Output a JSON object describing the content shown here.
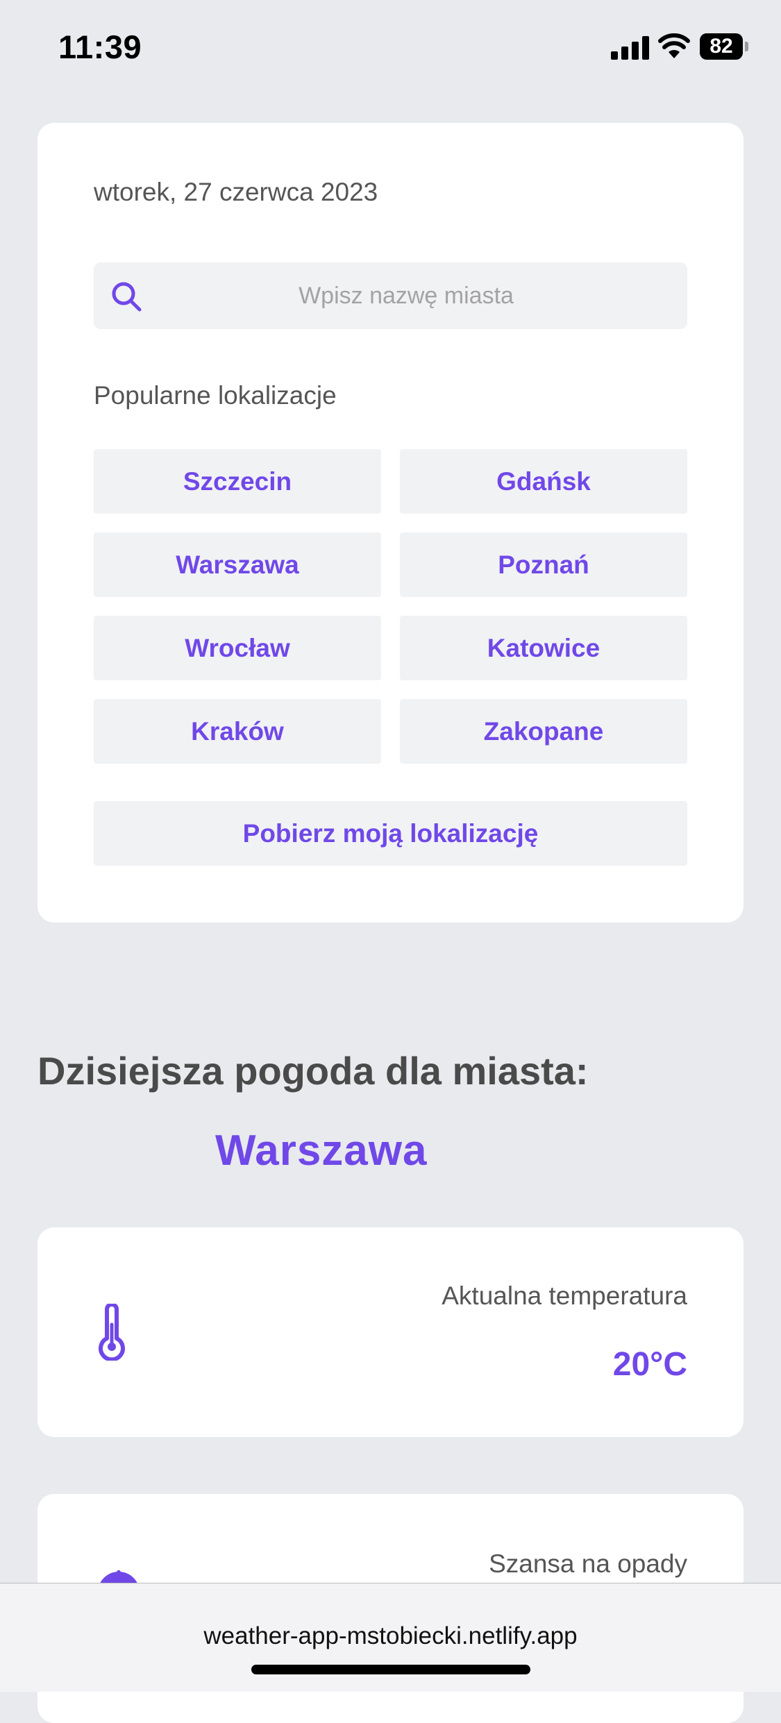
{
  "status_bar": {
    "time": "11:39",
    "battery": "82"
  },
  "search_card": {
    "date": "wtorek, 27 czerwca 2023",
    "search_placeholder": "Wpisz nazwę miasta",
    "popular_label": "Popularne lokalizacje",
    "cities": [
      "Szczecin",
      "Gdańsk",
      "Warszawa",
      "Poznań",
      "Wrocław",
      "Katowice",
      "Kraków",
      "Zakopane"
    ],
    "geolocation_button": "Pobierz moją lokalizację"
  },
  "weather": {
    "section_title": "Dzisiejsza pogoda dla miasta:",
    "city": "Warszawa",
    "temperature_label": "Aktualna temperatura",
    "temperature_value": "20°C",
    "rain_label": "Szansa na opady"
  },
  "browser": {
    "url": "weather-app-mstobiecki.netlify.app"
  },
  "colors": {
    "accent": "#7048e8",
    "background": "#e8eaed",
    "card": "#ffffff",
    "button_bg": "#f1f2f4"
  },
  "icons": [
    "signal-icon",
    "wifi-icon",
    "battery-icon",
    "search-icon",
    "thermometer-icon",
    "umbrella-icon"
  ]
}
